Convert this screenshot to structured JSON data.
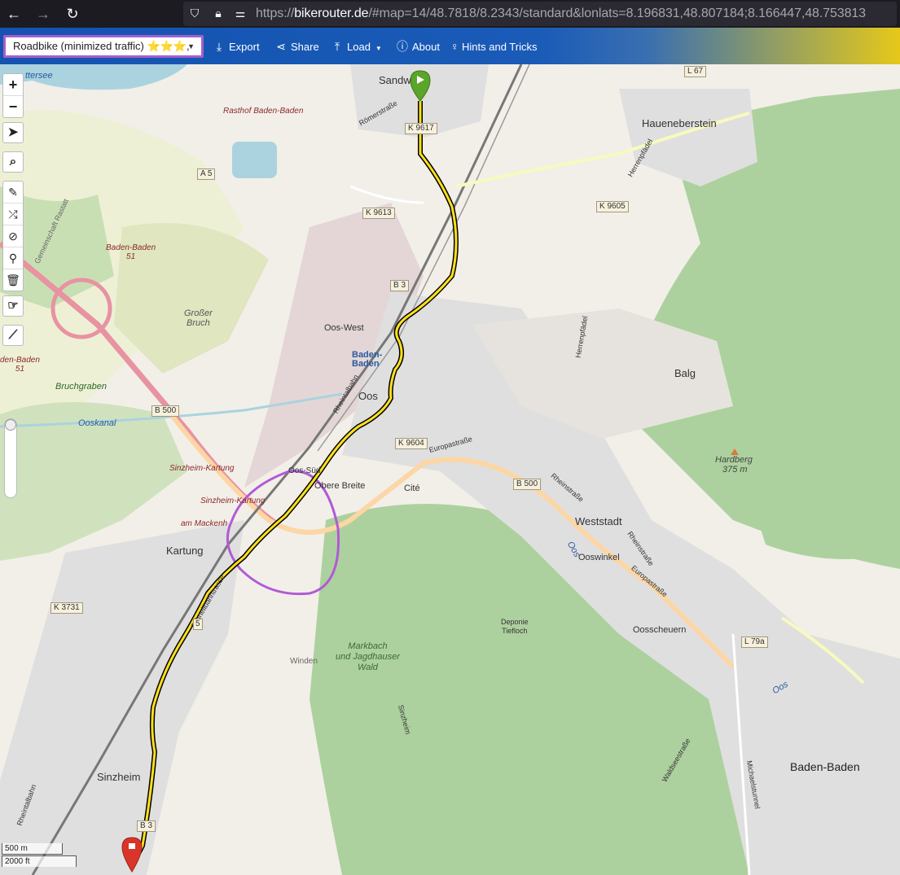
{
  "browser": {
    "url_prefix": "https://",
    "url_host": "bikerouter.de",
    "url_rest": "/#map=14/48.7818/8.2343/standard&lonlats=8.196831,48.807184;8.166447,48.753813"
  },
  "toolbar": {
    "profile_label": "Roadbike (minimized traffic) ⭐⭐⭐,",
    "export_label": "Export",
    "share_label": "Share",
    "load_label": "Load",
    "about_label": "About",
    "hints_label": "Hints and Tricks"
  },
  "map_controls": {
    "zoom_in": "+",
    "zoom_out": "−"
  },
  "scale": {
    "metric": "500 m",
    "imperial": "2000 ft"
  },
  "labels": {
    "sandweier": "Sandw",
    "haueneberstein": "Haueneberstein",
    "oos_west": "Oos-West",
    "baden_baden_airport": "Baden-\nBaden",
    "oos": "Oos",
    "balg": "Balg",
    "oos_sued": "Oos-Süd",
    "obere_breite": "Obere Breite",
    "cite": "Cité",
    "weststadt": "Weststadt",
    "ooswinkel": "Ooswinkel",
    "oosscheuern": "Oosscheuern",
    "kartung": "Kartung",
    "sinzheim": "Sinzheim",
    "baden_baden_city": "Baden-Baden",
    "hardberg": "Hardberg",
    "hardberg_elev": "375 m",
    "markbach": "Markbach\nund Jagdhauser\nWald",
    "deponie": "Deponie\nTiefloch",
    "winden": "Winden",
    "grosser_bruch": "Großer\nBruch",
    "bruchgraben": "Bruchgraben",
    "rasthof": "Rasthof Baden-Baden",
    "sinzheim_kartung1": "Sinzheim-Kartung",
    "sinzheim_kartung2": "Sinzheim-Kartung",
    "am_mackenheim": "am Mackenh",
    "baden_baden_51a": "Baden-Baden\n51",
    "baden_baden_51b": "den-Baden\n51",
    "romerstrasse": "Römerstraße",
    "herrenpfad1": "Herrenpfädel",
    "herrenpfad2": "Herrenpfädel",
    "europastrasse1": "Europastraße",
    "europastrasse2": "Europastraße",
    "rheinstrasse1": "Rheinstraße",
    "rheinstrasse2": "Rheinstraße",
    "schwarzwaldstrasse": "Schnellbahntrasse",
    "rheintalbahn1": "Rheintalbahn",
    "rheintalbahn2": "Rheintalbahn",
    "waldseestrasse": "Waldseestraße",
    "michaelstunnel": "Michaelstunnel",
    "ooskanal": "Ooskanal",
    "oos_river": "Oos",
    "sinzheim_strasse": "Sinzheim",
    "ttersee": "ttersee",
    "schaft_rastatt": "Gemeinschaft Rastatt"
  },
  "shields": {
    "k9617": "K 9617",
    "l67": "L 67",
    "a5": "A 5",
    "k9613": "K 9613",
    "k9605": "K 9605",
    "b3a": "B 3",
    "b500a": "B 500",
    "k9604": "K 9604",
    "b500b": "B 500",
    "k3731": "K 3731",
    "l79a": "L 79a",
    "b3b": "B 3",
    "five": "5"
  },
  "colors": {
    "toolbar_blue": "#1453b0",
    "route_yellow": "#ffe11a",
    "start_marker": "#5aa52a",
    "end_marker": "#d9352a",
    "highlight_circle": "#b15ad6",
    "forest": "#add19e"
  }
}
